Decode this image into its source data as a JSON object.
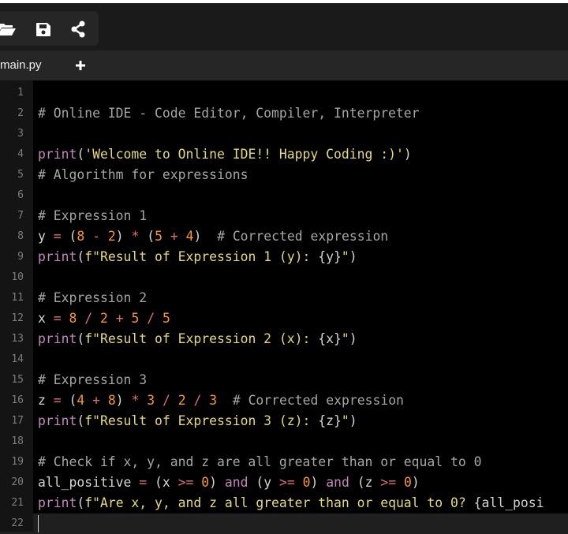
{
  "toolbar": {
    "buttons": [
      {
        "name": "open-folder-icon"
      },
      {
        "name": "save-icon"
      },
      {
        "name": "share-icon"
      }
    ]
  },
  "tabs": {
    "active": "main.py",
    "add_label": "+"
  },
  "colors": {
    "comment": "#a6a6a6",
    "keyword": "#c586c0",
    "string": "#e6db74",
    "number": "#fd971f",
    "operator": "#e06c75",
    "plain": "#d4d4d4",
    "line_number": "#7d7d7d"
  },
  "editor": {
    "line_numbers": [
      "1",
      "2",
      "3",
      "4",
      "5",
      "6",
      "7",
      "8",
      "9",
      "10",
      "11",
      "12",
      "13",
      "14",
      "15",
      "16",
      "17",
      "18",
      "19",
      "20",
      "21",
      "22"
    ],
    "active_line": 22,
    "lines": [
      [],
      [
        {
          "t": "# Online IDE - Code Editor, Compiler, Interpreter",
          "c": "comment"
        }
      ],
      [],
      [
        {
          "t": "print",
          "c": "keyword"
        },
        {
          "t": "(",
          "c": "plain"
        },
        {
          "t": "'Welcome to Online IDE!! Happy Coding :)'",
          "c": "string"
        },
        {
          "t": ")",
          "c": "plain"
        }
      ],
      [
        {
          "t": "# Algorithm for expressions",
          "c": "comment"
        }
      ],
      [],
      [
        {
          "t": "# Expression 1",
          "c": "comment"
        }
      ],
      [
        {
          "t": "y ",
          "c": "plain"
        },
        {
          "t": "=",
          "c": "operator"
        },
        {
          "t": " (",
          "c": "plain"
        },
        {
          "t": "8",
          "c": "number"
        },
        {
          "t": " - ",
          "c": "operator"
        },
        {
          "t": "2",
          "c": "number"
        },
        {
          "t": ") ",
          "c": "plain"
        },
        {
          "t": "*",
          "c": "operator"
        },
        {
          "t": " (",
          "c": "plain"
        },
        {
          "t": "5",
          "c": "number"
        },
        {
          "t": " + ",
          "c": "operator"
        },
        {
          "t": "4",
          "c": "number"
        },
        {
          "t": ")  ",
          "c": "plain"
        },
        {
          "t": "# Corrected expression",
          "c": "comment"
        }
      ],
      [
        {
          "t": "print",
          "c": "keyword"
        },
        {
          "t": "(",
          "c": "plain"
        },
        {
          "t": "f\"Result of Expression 1 (y): ",
          "c": "string"
        },
        {
          "t": "{y}",
          "c": "plain"
        },
        {
          "t": "\"",
          "c": "string"
        },
        {
          "t": ")",
          "c": "plain"
        }
      ],
      [],
      [
        {
          "t": "# Expression 2",
          "c": "comment"
        }
      ],
      [
        {
          "t": "x ",
          "c": "plain"
        },
        {
          "t": "=",
          "c": "operator"
        },
        {
          "t": " ",
          "c": "plain"
        },
        {
          "t": "8",
          "c": "number"
        },
        {
          "t": " / ",
          "c": "operator"
        },
        {
          "t": "2",
          "c": "number"
        },
        {
          "t": " + ",
          "c": "operator"
        },
        {
          "t": "5",
          "c": "number"
        },
        {
          "t": " / ",
          "c": "operator"
        },
        {
          "t": "5",
          "c": "number"
        }
      ],
      [
        {
          "t": "print",
          "c": "keyword"
        },
        {
          "t": "(",
          "c": "plain"
        },
        {
          "t": "f\"Result of Expression 2 (x): ",
          "c": "string"
        },
        {
          "t": "{x}",
          "c": "plain"
        },
        {
          "t": "\"",
          "c": "string"
        },
        {
          "t": ")",
          "c": "plain"
        }
      ],
      [],
      [
        {
          "t": "# Expression 3",
          "c": "comment"
        }
      ],
      [
        {
          "t": "z ",
          "c": "plain"
        },
        {
          "t": "=",
          "c": "operator"
        },
        {
          "t": " (",
          "c": "plain"
        },
        {
          "t": "4",
          "c": "number"
        },
        {
          "t": " + ",
          "c": "operator"
        },
        {
          "t": "8",
          "c": "number"
        },
        {
          "t": ") ",
          "c": "plain"
        },
        {
          "t": "*",
          "c": "operator"
        },
        {
          "t": " ",
          "c": "plain"
        },
        {
          "t": "3",
          "c": "number"
        },
        {
          "t": " / ",
          "c": "operator"
        },
        {
          "t": "2",
          "c": "number"
        },
        {
          "t": " / ",
          "c": "operator"
        },
        {
          "t": "3",
          "c": "number"
        },
        {
          "t": "  ",
          "c": "plain"
        },
        {
          "t": "# Corrected expression",
          "c": "comment"
        }
      ],
      [
        {
          "t": "print",
          "c": "keyword"
        },
        {
          "t": "(",
          "c": "plain"
        },
        {
          "t": "f\"Result of Expression 3 (z): ",
          "c": "string"
        },
        {
          "t": "{z}",
          "c": "plain"
        },
        {
          "t": "\"",
          "c": "string"
        },
        {
          "t": ")",
          "c": "plain"
        }
      ],
      [],
      [
        {
          "t": "# Check if x, y, and z are all greater than or equal to 0",
          "c": "comment"
        }
      ],
      [
        {
          "t": "all_positive ",
          "c": "plain"
        },
        {
          "t": "=",
          "c": "operator"
        },
        {
          "t": " (x ",
          "c": "plain"
        },
        {
          "t": ">=",
          "c": "operator"
        },
        {
          "t": " ",
          "c": "plain"
        },
        {
          "t": "0",
          "c": "number"
        },
        {
          "t": ") ",
          "c": "plain"
        },
        {
          "t": "and",
          "c": "keyword"
        },
        {
          "t": " (y ",
          "c": "plain"
        },
        {
          "t": ">=",
          "c": "operator"
        },
        {
          "t": " ",
          "c": "plain"
        },
        {
          "t": "0",
          "c": "number"
        },
        {
          "t": ") ",
          "c": "plain"
        },
        {
          "t": "and",
          "c": "keyword"
        },
        {
          "t": " (z ",
          "c": "plain"
        },
        {
          "t": ">=",
          "c": "operator"
        },
        {
          "t": " ",
          "c": "plain"
        },
        {
          "t": "0",
          "c": "number"
        },
        {
          "t": ")",
          "c": "plain"
        }
      ],
      [
        {
          "t": "print",
          "c": "keyword"
        },
        {
          "t": "(",
          "c": "plain"
        },
        {
          "t": "f\"Are x, y, and z all greater than or equal to 0? ",
          "c": "string"
        },
        {
          "t": "{all_posi",
          "c": "plain"
        }
      ],
      []
    ]
  }
}
